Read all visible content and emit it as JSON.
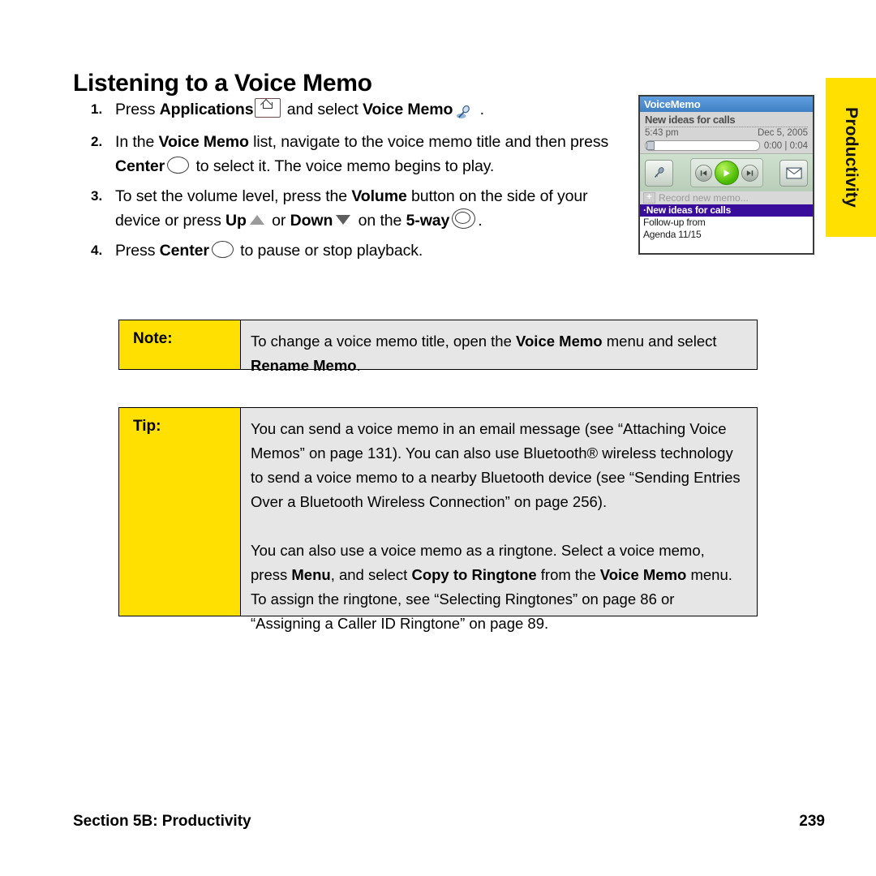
{
  "page": {
    "title": "Listening to a Voice Memo",
    "side_tab_label": "Productivity",
    "footer_left": "Section 5B: Productivity",
    "footer_page_number": "239"
  },
  "steps": [
    {
      "number": "1.",
      "parts": [
        {
          "t": "Press ",
          "b": false
        },
        {
          "t": "Applications",
          "b": true
        },
        {
          "t": "icon:home",
          "b": false
        },
        {
          "t": " and select ",
          "b": false
        },
        {
          "t": "Voice Memo",
          "b": true
        },
        {
          "t": "icon:voicememo",
          "b": false
        },
        {
          "t": " .",
          "b": false
        }
      ]
    },
    {
      "number": "2.",
      "parts": [
        {
          "t": "In the ",
          "b": false
        },
        {
          "t": "Voice Memo",
          "b": true
        },
        {
          "t": " list, navigate to the voice memo title and then press ",
          "b": false
        },
        {
          "t": "Center",
          "b": true
        },
        {
          "t": "icon:center",
          "b": false
        },
        {
          "t": " to select it. The voice memo begins to play.",
          "b": false
        }
      ]
    },
    {
      "number": "3.",
      "parts": [
        {
          "t": "To set the volume level, press the ",
          "b": false
        },
        {
          "t": "Volume",
          "b": true
        },
        {
          "t": " button on the side of your device or press ",
          "b": false
        },
        {
          "t": "Up",
          "b": true
        },
        {
          "t": "icon:up",
          "b": false
        },
        {
          "t": " or ",
          "b": false
        },
        {
          "t": "Down",
          "b": true
        },
        {
          "t": "icon:down",
          "b": false
        },
        {
          "t": " on the ",
          "b": false
        },
        {
          "t": "5-way",
          "b": true
        },
        {
          "t": "icon:5way",
          "b": false
        },
        {
          "t": ".",
          "b": false
        }
      ]
    },
    {
      "number": "4.",
      "parts": [
        {
          "t": "Press ",
          "b": false
        },
        {
          "t": "Center",
          "b": true
        },
        {
          "t": "icon:center",
          "b": false
        },
        {
          "t": " to pause or stop playback.",
          "b": false
        }
      ]
    }
  ],
  "note": {
    "label": "Note:",
    "paragraphs": [
      [
        {
          "t": "To change a voice memo title, open the ",
          "b": false
        },
        {
          "t": "Voice Memo",
          "b": true
        },
        {
          "t": " menu and select ",
          "b": false
        },
        {
          "t": "Rename Memo",
          "b": true
        },
        {
          "t": ".",
          "b": false
        }
      ]
    ]
  },
  "tip": {
    "label": "Tip:",
    "paragraphs": [
      [
        {
          "t": "You can send a voice memo in an email message (see “Attaching Voice Memos” on page 131). You can also use Bluetooth® wireless technology to send a voice memo to a nearby Bluetooth device (see “Sending Entries Over a Bluetooth Wireless Connection” on page 256).",
          "b": false
        }
      ],
      [
        {
          "t": "You can also use a voice memo as a ringtone. Select a voice memo, press ",
          "b": false
        },
        {
          "t": "Menu",
          "b": true
        },
        {
          "t": ", and select ",
          "b": false
        },
        {
          "t": "Copy to Ringtone",
          "b": true
        },
        {
          "t": " from the ",
          "b": false
        },
        {
          "t": "Voice Memo",
          "b": true
        },
        {
          "t": " menu. To assign the ringtone, see “Selecting Ringtones” on page 86 or “Assigning a Caller ID Ringtone” on page 89.",
          "b": false
        }
      ]
    ]
  },
  "phone_screenshot": {
    "titlebar": "VoiceMemo",
    "memo_title": "New ideas for calls",
    "time": "5:43 pm",
    "date": "Dec 5, 2005",
    "elapsed": "0:00",
    "separator": "|",
    "duration": "0:04",
    "record_new_label": "Record new memo...",
    "plus_glyph": "+",
    "list_items": [
      {
        "label": "New ideas for calls",
        "selected": true
      },
      {
        "label": "Follow-up from",
        "selected": false
      },
      {
        "label": "Agenda 11/15",
        "selected": false
      }
    ],
    "colors": {
      "titlebar": "#4f8fd4",
      "selection": "#3a0c9c",
      "play_button": "#46b800",
      "info_panel": "#d5d5d5"
    }
  },
  "colors": {
    "accent_yellow": "#ffe000",
    "callout_body": "#e6e6e6",
    "text": "#000000"
  }
}
